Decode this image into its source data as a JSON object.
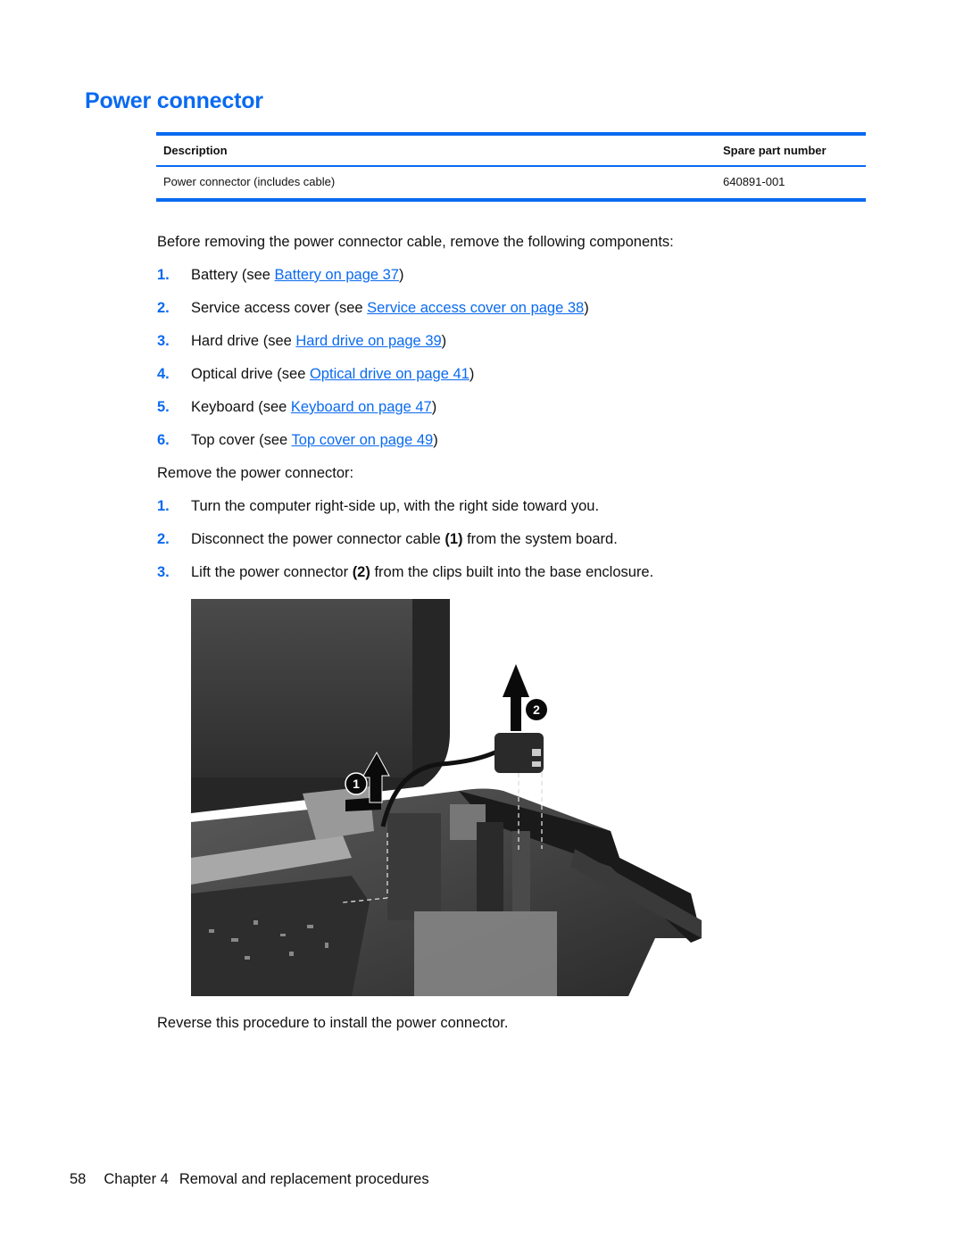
{
  "page": {
    "title": "Power connector",
    "accent_color": "#0a6af0"
  },
  "parts_table": {
    "headers": [
      "Description",
      "Spare part number"
    ],
    "rows": [
      [
        "Power connector (includes cable)",
        "640891-001"
      ]
    ]
  },
  "prereq": {
    "intro": "Before removing the power connector cable, remove the following components:",
    "items": [
      {
        "num": "1.",
        "before": "Battery (see ",
        "link": "Battery on page 37",
        "after": ")"
      },
      {
        "num": "2.",
        "before": "Service access cover (see ",
        "link": "Service access cover on page 38",
        "after": ")"
      },
      {
        "num": "3.",
        "before": "Hard drive (see ",
        "link": "Hard drive on page 39",
        "after": ")"
      },
      {
        "num": "4.",
        "before": "Optical drive (see ",
        "link": "Optical drive on page 41",
        "after": ")"
      },
      {
        "num": "5.",
        "before": "Keyboard (see ",
        "link": "Keyboard on page 47",
        "after": ")"
      },
      {
        "num": "6.",
        "before": "Top cover (see ",
        "link": "Top cover on page 49",
        "after": ")"
      }
    ]
  },
  "removal": {
    "intro": "Remove the power connector:",
    "steps": [
      {
        "num": "1.",
        "before": "Turn the computer right-side up, with the right side toward you.",
        "bold": "",
        "after": ""
      },
      {
        "num": "2.",
        "before": "Disconnect the power connector cable ",
        "bold": "(1)",
        "after": " from the system board."
      },
      {
        "num": "3.",
        "before": "Lift the power connector ",
        "bold": "(2)",
        "after": " from the clips built into the base enclosure."
      }
    ]
  },
  "figure": {
    "callouts": [
      "1",
      "2"
    ],
    "description": "Photo of laptop base with power connector cable and connector being lifted"
  },
  "closing": "Reverse this procedure to install the power connector.",
  "footer": {
    "page_number": "58",
    "chapter": "Chapter 4",
    "chapter_title": "Removal and replacement procedures"
  }
}
